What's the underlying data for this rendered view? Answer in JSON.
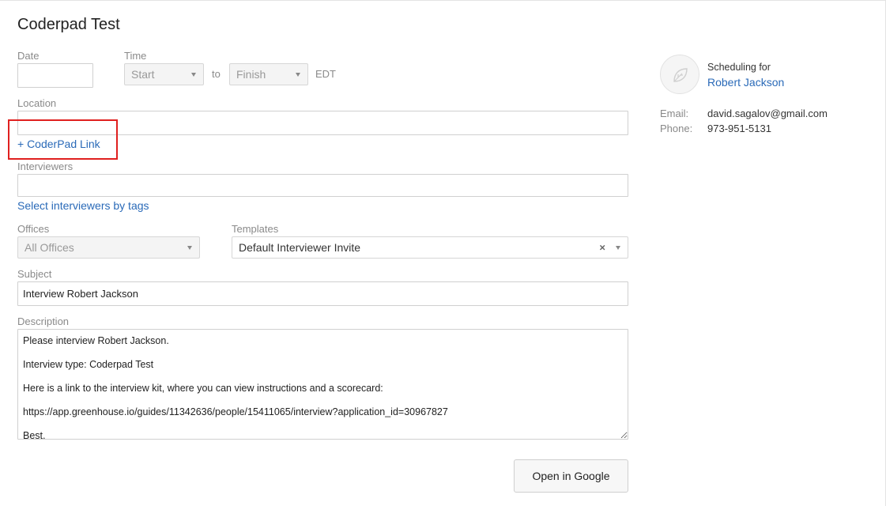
{
  "page": {
    "title": "Coderpad Test"
  },
  "date": {
    "label": "Date",
    "value": ""
  },
  "time": {
    "label": "Time",
    "start": "Start",
    "to": "to",
    "finish": "Finish",
    "timezone": "EDT"
  },
  "location": {
    "label": "Location",
    "value": "",
    "coderpad_link": "+ CoderPad Link"
  },
  "interviewers": {
    "label": "Interviewers",
    "value": "",
    "select_by_tags": "Select interviewers by tags"
  },
  "offices": {
    "label": "Offices",
    "selected": "All Offices"
  },
  "templates": {
    "label": "Templates",
    "selected": "Default Interviewer Invite",
    "clear": "×"
  },
  "subject": {
    "label": "Subject",
    "value": "Interview Robert Jackson"
  },
  "description": {
    "label": "Description",
    "value": "Please interview Robert Jackson.\n\nInterview type: Coderpad Test\n\nHere is a link to the interview kit, where you can view instructions and a scorecard:\n\nhttps://app.greenhouse.io/guides/11342636/people/15411065/interview?application_id=30967827\n\nBest,"
  },
  "actions": {
    "open_in_google": "Open in Google"
  },
  "candidate": {
    "scheduling_for": "Scheduling for",
    "name": "Robert Jackson",
    "email_label": "Email:",
    "email": "david.sagalov@gmail.com",
    "phone_label": "Phone:",
    "phone": "973-951-5131",
    "avatar_icon": "leaf-icon"
  },
  "colors": {
    "link": "#2a6ab8",
    "highlight": "#e0201f"
  }
}
